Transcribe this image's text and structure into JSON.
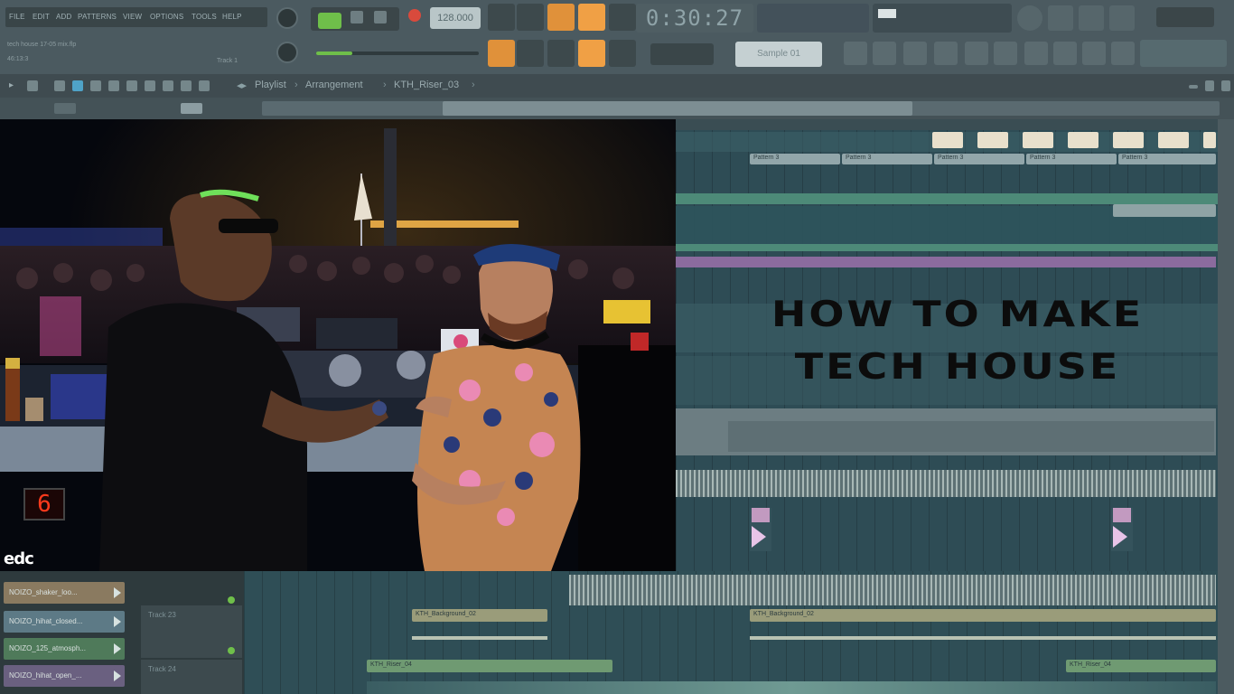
{
  "app": {
    "menu": [
      "FILE",
      "EDIT",
      "ADD",
      "PATTERNS",
      "VIEW",
      "OPTIONS",
      "TOOLS",
      "HELP"
    ],
    "hint_line": "tech house 17-05 mix.flp",
    "hint_line2": "46:13:3",
    "track_label": "Track 1",
    "tempo": "128.000",
    "time_display": "0:30:27",
    "pattern_selector": "Sample 01"
  },
  "playlist": {
    "breadcrumb": [
      "Playlist",
      "Arrangement",
      "KTH_Riser_03"
    ]
  },
  "overlay": {
    "headline_line1": "HOW TO MAKE",
    "headline_line2": "TECH HOUSE",
    "photo_logo": "edc",
    "booth_number": "6"
  },
  "channels": [
    {
      "label": "NOIZO_shaker_loo...",
      "color": "#8a7a60"
    },
    {
      "label": "NOIZO_hihat_closed...",
      "color": "#5d7a86"
    },
    {
      "label": "NOIZO_125_atmosph...",
      "color": "#4f7a5a"
    },
    {
      "label": "NOIZO_hihat_open_...",
      "color": "#6a6080"
    }
  ],
  "tracks": [
    {
      "label": "Track 23"
    },
    {
      "label": "Track 24"
    }
  ],
  "clips": {
    "top_row": [
      "Pattern 3",
      "Pattern 3",
      "Pattern 3",
      "Pattern 3",
      "Pattern 3"
    ],
    "bottom_a": "KTH_Background_02",
    "bottom_b": "KTH_Background_02",
    "bottom_c": "KTH_Riser_04",
    "bottom_d": "KTH_Riser_04"
  },
  "colors": {
    "accent_orange": "#e0913a",
    "play_green": "#6fbf4a",
    "record_red": "#d94a3c",
    "playlist_bg": "#2e4c55"
  }
}
